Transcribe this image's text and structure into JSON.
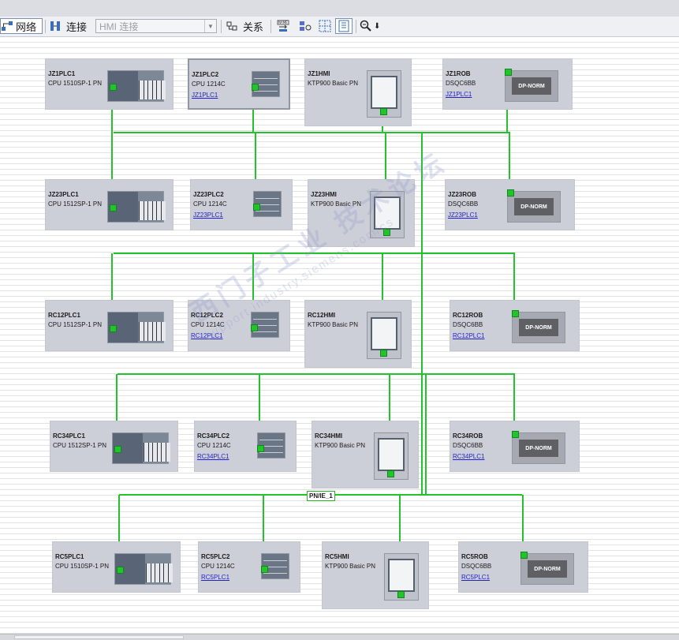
{
  "toolbar": {
    "network_label": "网络",
    "connections_label": "连接",
    "connection_type_value": "HMI 连接",
    "relations_label": "关系",
    "icons": [
      "network-view-icon",
      "connections-icon",
      "relations-icon",
      "show-address-icon",
      "highlight-icon",
      "grid-icon",
      "properties-panel-icon",
      "zoom-icon"
    ]
  },
  "network": {
    "subnet_label": "PN/IE_1",
    "line_color": "#22c32c"
  },
  "devices": [
    {
      "name": "JZ1PLC1",
      "type": "CPU 1510SP-1 PN",
      "link": ""
    },
    {
      "name": "JZ1PLC2",
      "type": "CPU 1214C",
      "link": "JZ1PLC1"
    },
    {
      "name": "JZ1HMI",
      "type": "KTP900 Basic PN",
      "link": ""
    },
    {
      "name": "JZ1ROB",
      "type": "DSQC6BB",
      "link": "JZ1PLC1"
    },
    {
      "name": "JZ23PLC1",
      "type": "CPU 1512SP-1 PN",
      "link": ""
    },
    {
      "name": "JZ23PLC2",
      "type": "CPU 1214C",
      "link": "JZ23PLC1"
    },
    {
      "name": "JZ23HMI",
      "type": "KTP900 Basic PN",
      "link": ""
    },
    {
      "name": "JZ23ROB",
      "type": "DSQC6BB",
      "link": "JZ23PLC1"
    },
    {
      "name": "RC12PLC1",
      "type": "CPU 1512SP-1 PN",
      "link": ""
    },
    {
      "name": "RC12PLC2",
      "type": "CPU 1214C",
      "link": "RC12PLC1"
    },
    {
      "name": "RC12HMI",
      "type": "KTP900 Basic PN",
      "link": ""
    },
    {
      "name": "RC12ROB",
      "type": "DSQC6BB",
      "link": "RC12PLC1"
    },
    {
      "name": "RC34PLC1",
      "type": "CPU 1512SP-1 PN",
      "link": ""
    },
    {
      "name": "RC34PLC2",
      "type": "CPU 1214C",
      "link": "RC34PLC1"
    },
    {
      "name": "RC34HMI",
      "type": "KTP900 Basic PN",
      "link": ""
    },
    {
      "name": "RC34ROB",
      "type": "DSQC6BB",
      "link": "RC34PLC1"
    },
    {
      "name": "RC5PLC1",
      "type": "CPU 1510SP-1 PN",
      "link": ""
    },
    {
      "name": "RC5PLC2",
      "type": "CPU 1214C",
      "link": "RC5PLC1"
    },
    {
      "name": "RC5HMI",
      "type": "KTP900 Basic PN",
      "link": ""
    },
    {
      "name": "RC5ROB",
      "type": "DSQC6BB",
      "link": "RC5PLC1"
    }
  ],
  "robot_module_label": "DP-NORM",
  "watermark": {
    "text_cn": "西门子工业 技术论坛",
    "text_url": "support.industry.siemens.com/cs"
  }
}
